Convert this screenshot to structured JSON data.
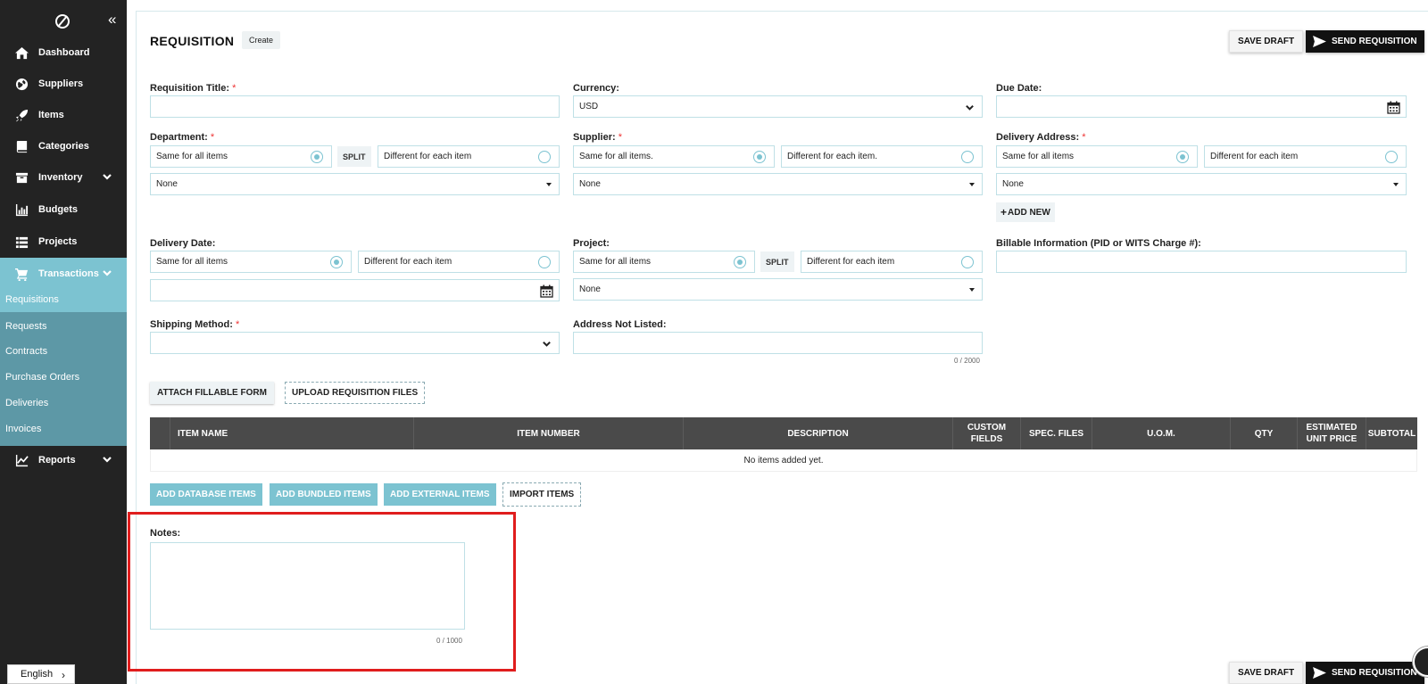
{
  "sidebar": {
    "items": [
      {
        "label": "Dashboard",
        "icon": "home-icon"
      },
      {
        "label": "Suppliers",
        "icon": "globe-icon"
      },
      {
        "label": "Items",
        "icon": "rocket-icon"
      },
      {
        "label": "Categories",
        "icon": "book-icon"
      },
      {
        "label": "Inventory",
        "icon": "box-icon"
      },
      {
        "label": "Budgets",
        "icon": "bar-chart-icon"
      },
      {
        "label": "Projects",
        "icon": "list-icon"
      },
      {
        "label": "Transactions",
        "icon": "cart-icon"
      },
      {
        "label": "Reports",
        "icon": "line-chart-icon"
      }
    ],
    "sub_items": [
      "Requisitions",
      "Requests",
      "Contracts",
      "Purchase Orders",
      "Deliveries",
      "Invoices"
    ],
    "language": "English",
    "collapse_glyph": "«"
  },
  "header": {
    "title": "REQUISITION",
    "badge": "Create",
    "save_draft": "SAVE DRAFT",
    "send": "SEND REQUISITION"
  },
  "form": {
    "requisition_title": {
      "label": "Requisition Title:",
      "required": "*",
      "value": ""
    },
    "currency": {
      "label": "Currency:",
      "value": "USD"
    },
    "due_date": {
      "label": "Due Date:",
      "value": ""
    },
    "department": {
      "label": "Department:",
      "required": "*",
      "same": "Same for all items",
      "split": "SPLIT",
      "different": "Different for each item",
      "select": "None"
    },
    "supplier": {
      "label": "Supplier:",
      "required": "*",
      "same": "Same for all items.",
      "different": "Different for each item.",
      "select": "None"
    },
    "delivery_address": {
      "label": "Delivery Address:",
      "required": "*",
      "same": "Same for all items",
      "different": "Different for each item",
      "select": "None",
      "add_new": "ADD NEW"
    },
    "delivery_date": {
      "label": "Delivery Date:",
      "same": "Same for all items",
      "different": "Different for each item",
      "value": ""
    },
    "project": {
      "label": "Project:",
      "same": "Same for all items",
      "split": "SPLIT",
      "different": "Different for each item",
      "select": "None"
    },
    "billable": {
      "label": "Billable Information (PID or WITS Charge #):",
      "value": ""
    },
    "shipping": {
      "label": "Shipping Method:",
      "required": "*",
      "value": ""
    },
    "address_not_listed": {
      "label": "Address Not Listed:",
      "value": "",
      "counter": "0 / 2000"
    }
  },
  "file_buttons": {
    "attach": "ATTACH FILLABLE FORM",
    "upload": "UPLOAD REQUISITION FILES"
  },
  "table": {
    "columns": [
      "ITEM NAME",
      "ITEM NUMBER",
      "DESCRIPTION",
      "CUSTOM FIELDS",
      "SPEC. FILES",
      "U.O.M.",
      "QTY",
      "ESTIMATED UNIT PRICE",
      "SUBTOTAL"
    ],
    "empty": "No items added yet."
  },
  "item_buttons": {
    "database": "ADD DATABASE ITEMS",
    "bundled": "ADD BUNDLED ITEMS",
    "external": "ADD EXTERNAL ITEMS",
    "import": "IMPORT ITEMS"
  },
  "notes": {
    "label": "Notes:",
    "value": "",
    "counter": "0 / 1000"
  },
  "footer": {
    "save_draft": "SAVE DRAFT",
    "send": "SEND REQUISITION"
  },
  "colors": {
    "accent": "#7cc3d1",
    "sidebar": "#232323",
    "submenu": "#5d98a6",
    "highlight_box": "#e01d1d"
  }
}
